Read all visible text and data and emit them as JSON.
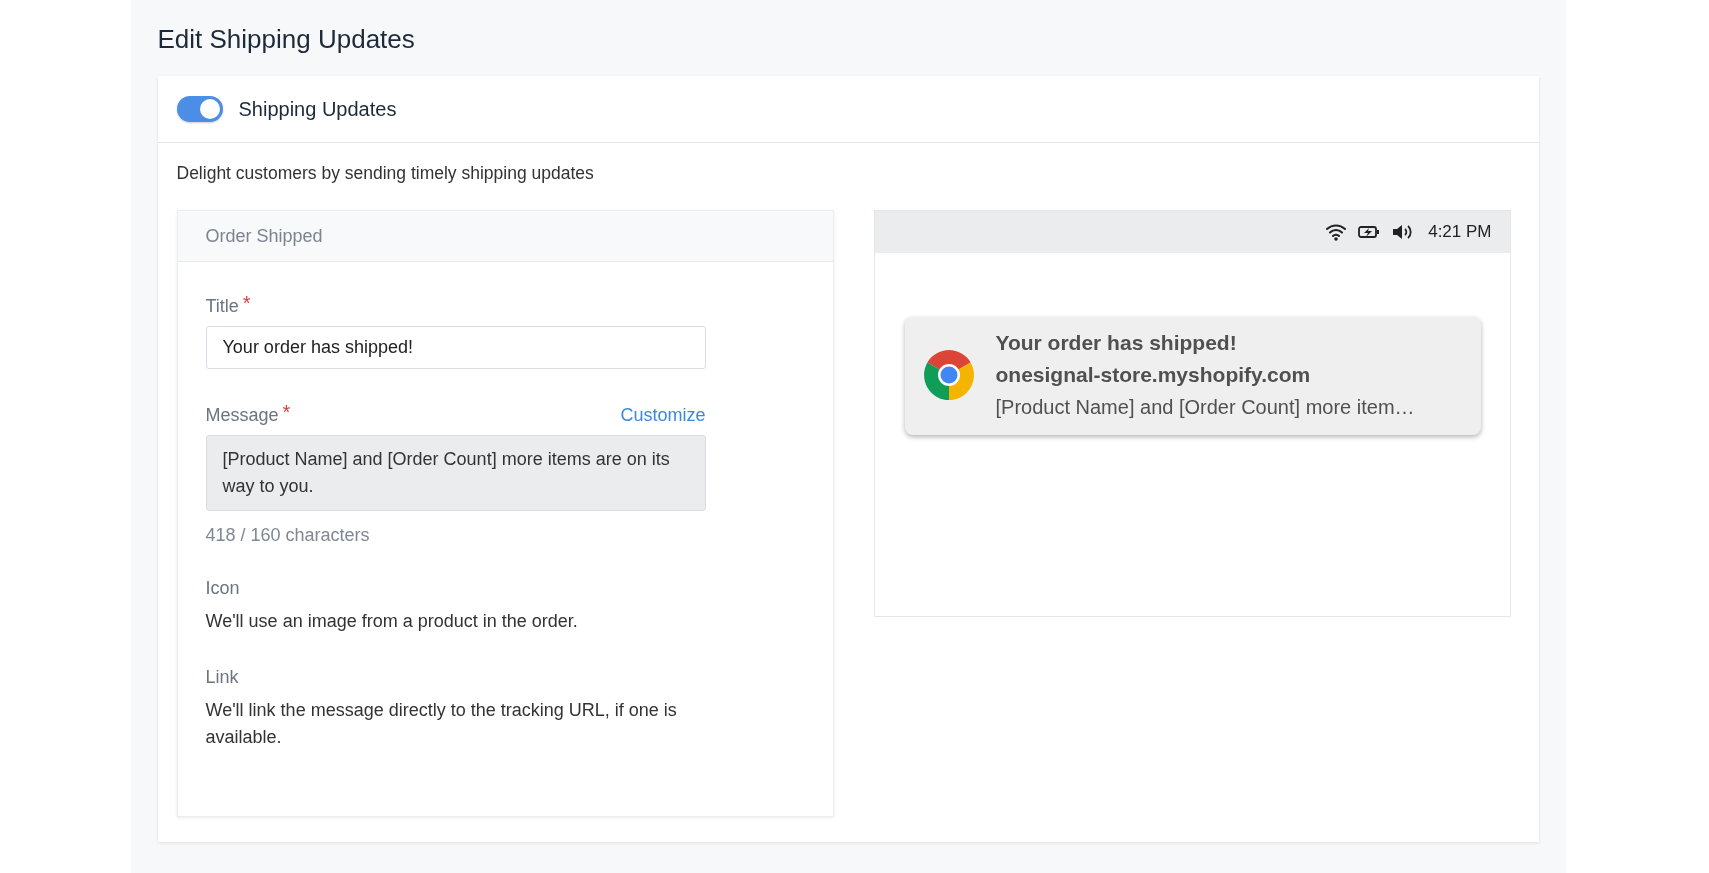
{
  "page_title": "Edit Shipping Updates",
  "toggle": {
    "label": "Shipping Updates",
    "on": true
  },
  "description": "Delight customers by sending timely shipping updates",
  "form": {
    "header": "Order Shipped",
    "title_field": {
      "label": "Title",
      "required_mark": "*",
      "value": "Your order has shipped!"
    },
    "message_field": {
      "label": "Message",
      "required_mark": "*",
      "action": "Customize",
      "value": "[Product Name] and [Order Count] more items are on its way to you.",
      "disabled": true,
      "counter": "418 / 160 characters"
    },
    "info": [
      {
        "label": "Icon",
        "text": "We'll use an image from a product in the order."
      },
      {
        "label": "Link",
        "text": "We'll link the message directly to the tracking URL, if one is available."
      }
    ]
  },
  "preview": {
    "time": "4:21 PM",
    "notification": {
      "title": "Your order has shipped!",
      "site": "onesignal-store.myshopify.com",
      "message": "[Product Name] and [Order Count] more item…"
    }
  }
}
